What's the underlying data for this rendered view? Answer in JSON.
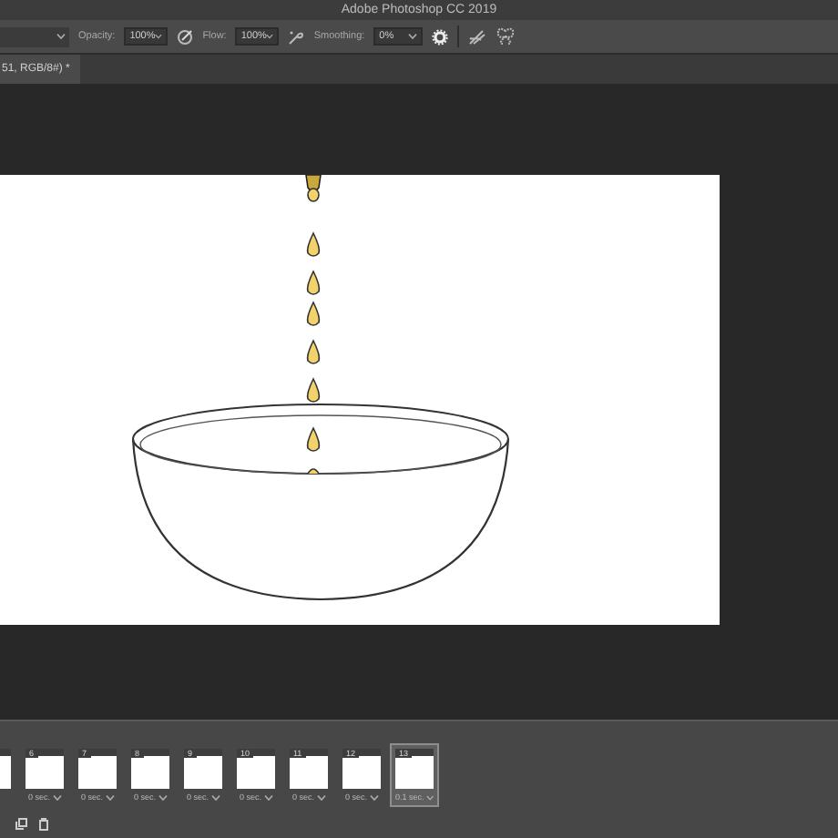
{
  "window": {
    "title": "Adobe Photoshop CC 2019"
  },
  "options_bar": {
    "opacity_label": "Opacity:",
    "opacity": "100%",
    "flow_label": "Flow:",
    "flow": "100%",
    "smoothing_label": "Smoothing:",
    "smoothing": "0%"
  },
  "document_tab": {
    "title": "51, RGB/8#) *"
  },
  "timeline": {
    "frames": [
      {
        "selected": false
      },
      {
        "number": "6",
        "delay": "0 sec.",
        "selected": false
      },
      {
        "number": "7",
        "delay": "0 sec.",
        "selected": false
      },
      {
        "number": "8",
        "delay": "0 sec.",
        "selected": false
      },
      {
        "number": "9",
        "delay": "0 sec.",
        "selected": false
      },
      {
        "number": "10",
        "delay": "0 sec.",
        "selected": false
      },
      {
        "number": "11",
        "delay": "0 sec.",
        "selected": false
      },
      {
        "number": "12",
        "delay": "0 sec.",
        "selected": false
      },
      {
        "number": "13",
        "delay": "0.1 sec.",
        "selected": true
      }
    ]
  }
}
